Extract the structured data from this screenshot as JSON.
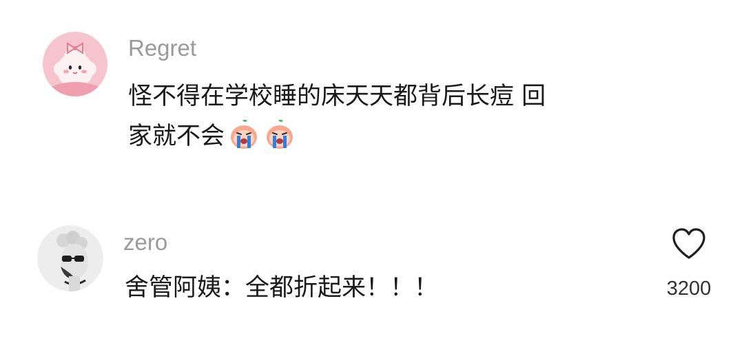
{
  "comments": [
    {
      "username": "Regret",
      "text_line1": "怪不得在学校睡的床天天都背后长痘 回",
      "text_line2": "家就不会",
      "avatar_icon": "bow-bunny-avatar-icon",
      "emojis": [
        "crying-emoji-icon",
        "crying-emoji-icon"
      ]
    },
    {
      "username": "zero",
      "text": "舍管阿姨：全都折起来！！！",
      "avatar_icon": "statue-avatar-icon",
      "like_count": "3200",
      "like_icon": "heart-outline-icon"
    }
  ],
  "colors": {
    "username": "#9a9a9a",
    "text": "#1a1a1a",
    "like_count": "#333333",
    "avatar_pink": "#f2b8c3"
  }
}
